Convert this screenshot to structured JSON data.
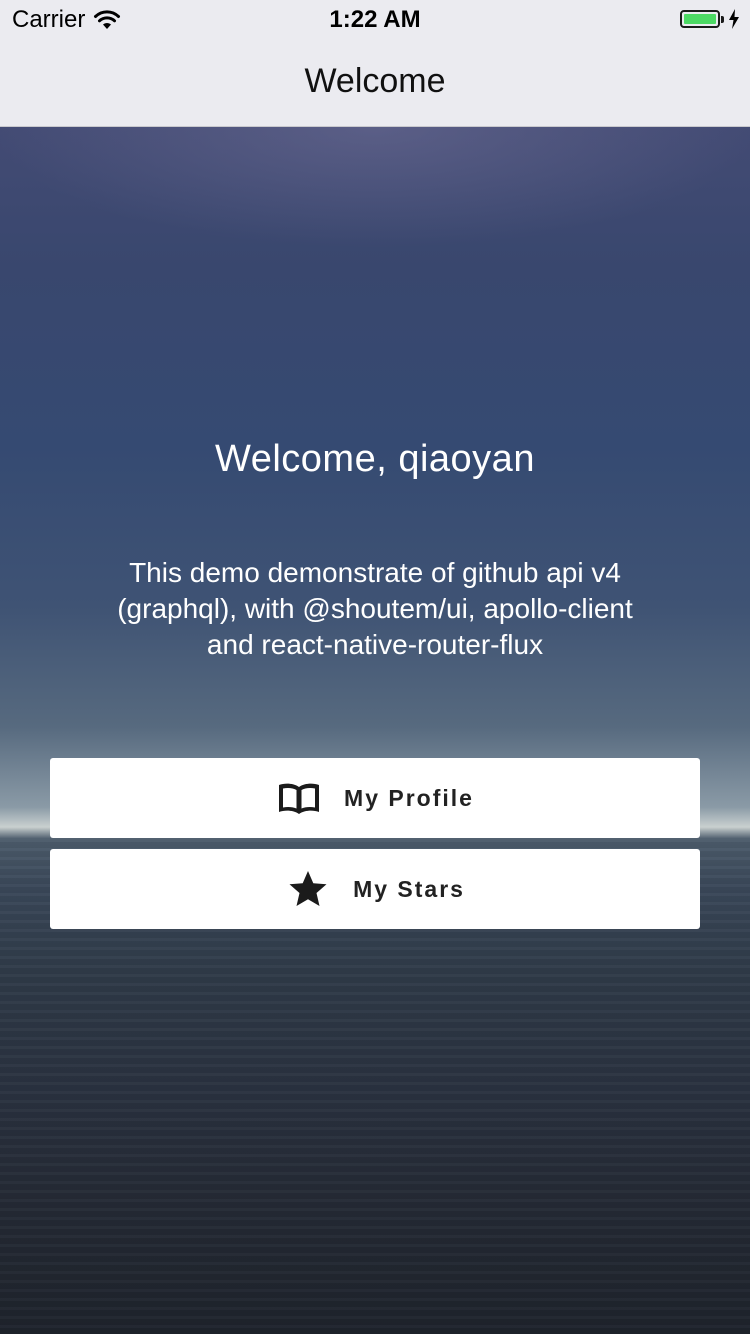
{
  "status_bar": {
    "carrier": "Carrier",
    "time": "1:22 AM",
    "wifi_icon": "wifi-icon",
    "battery_icon": "battery-icon",
    "charging_icon": "charging-bolt-icon",
    "battery_color": "#4cd964",
    "battery_level": 1.0
  },
  "nav": {
    "title": "Welcome"
  },
  "main": {
    "heading": "Welcome, qiaoyan",
    "description": "This demo demonstrate of github api v4 (graphql), with @shoutem/ui, apollo-client and react-native-router-flux",
    "buttons": [
      {
        "label": "My Profile",
        "icon": "book-icon"
      },
      {
        "label": "My Stars",
        "icon": "star-icon"
      }
    ]
  }
}
